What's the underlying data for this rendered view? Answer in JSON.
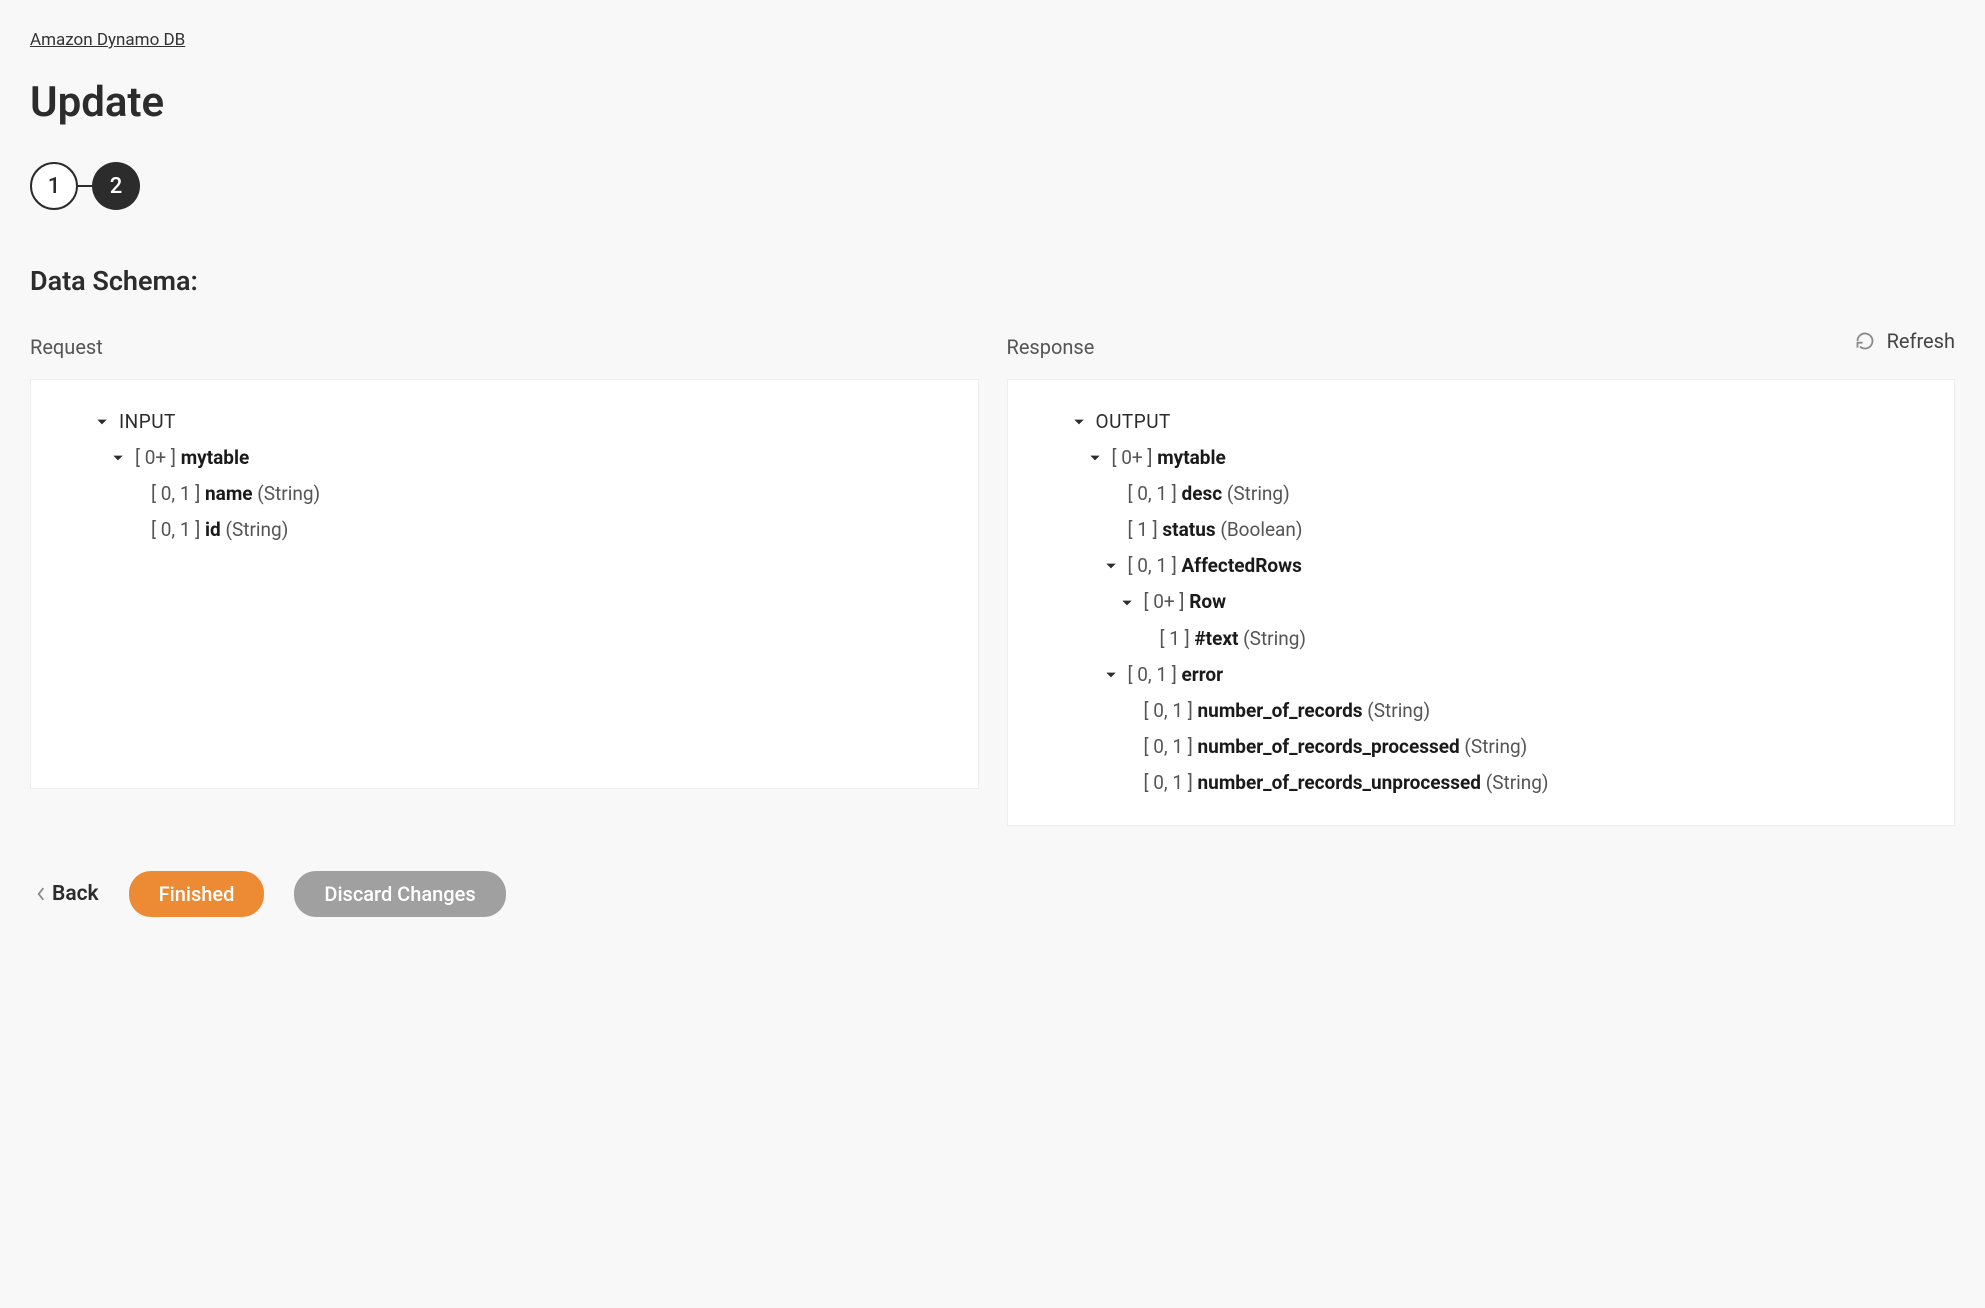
{
  "breadcrumb": "Amazon Dynamo DB",
  "title": "Update",
  "steps": {
    "one": "1",
    "two": "2"
  },
  "section_title": "Data Schema:",
  "refresh_label": "Refresh",
  "columns": {
    "request_label": "Request",
    "response_label": "Response"
  },
  "request": {
    "root": "INPUT",
    "mytable": {
      "card": "[ 0+ ]",
      "name": "mytable"
    },
    "name_field": {
      "card": "[ 0, 1 ]",
      "name": "name",
      "type": "(String)"
    },
    "id_field": {
      "card": "[ 0, 1 ]",
      "name": "id",
      "type": "(String)"
    }
  },
  "response": {
    "root": "OUTPUT",
    "mytable": {
      "card": "[ 0+ ]",
      "name": "mytable"
    },
    "desc": {
      "card": "[ 0, 1 ]",
      "name": "desc",
      "type": "(String)"
    },
    "status": {
      "card": "[ 1 ]",
      "name": "status",
      "type": "(Boolean)"
    },
    "affected": {
      "card": "[ 0, 1 ]",
      "name": "AffectedRows"
    },
    "row": {
      "card": "[ 0+ ]",
      "name": "Row"
    },
    "text": {
      "card": "[ 1 ]",
      "name": "#text",
      "type": "(String)"
    },
    "error": {
      "card": "[ 0, 1 ]",
      "name": "error"
    },
    "num_records": {
      "card": "[ 0, 1 ]",
      "name": "number_of_records",
      "type": "(String)"
    },
    "num_processed": {
      "card": "[ 0, 1 ]",
      "name": "number_of_records_processed",
      "type": "(String)"
    },
    "num_unprocessed": {
      "card": "[ 0, 1 ]",
      "name": "number_of_records_unprocessed",
      "type": "(String)"
    }
  },
  "footer": {
    "back": "Back",
    "finished": "Finished",
    "discard": "Discard Changes"
  }
}
